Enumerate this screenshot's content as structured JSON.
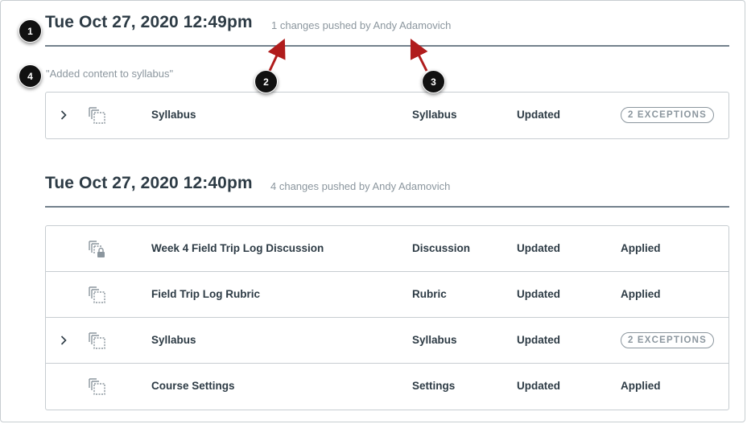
{
  "groups": [
    {
      "timestamp": "Tue Oct 27, 2020 12:49pm",
      "summary": "1 changes pushed by Andy Adamovich",
      "comment": "\"Added content to syllabus\"",
      "rows": [
        {
          "expandable": true,
          "icon": "copy-pages-icon",
          "name": "Syllabus",
          "type": "Syllabus",
          "action": "Updated",
          "badge": "2 EXCEPTIONS",
          "status": ""
        }
      ]
    },
    {
      "timestamp": "Tue Oct 27, 2020 12:40pm",
      "summary": "4 changes pushed by Andy Adamovich",
      "rows": [
        {
          "expandable": false,
          "icon": "locked-copy-icon",
          "name": "Week 4 Field Trip Log Discussion",
          "type": "Discussion",
          "action": "Updated",
          "status": "Applied"
        },
        {
          "expandable": false,
          "icon": "copy-pages-icon",
          "name": "Field Trip Log Rubric",
          "type": "Rubric",
          "action": "Updated",
          "status": "Applied"
        },
        {
          "expandable": true,
          "icon": "copy-pages-icon",
          "name": "Syllabus",
          "type": "Syllabus",
          "action": "Updated",
          "badge": "2 EXCEPTIONS",
          "status": ""
        },
        {
          "expandable": false,
          "icon": "copy-pages-icon",
          "name": "Course Settings",
          "type": "Settings",
          "action": "Updated",
          "status": "Applied"
        }
      ]
    }
  ],
  "markers": [
    "1",
    "2",
    "3",
    "4"
  ],
  "colors": {
    "marker": "#111111",
    "arrow": "#b01c1c",
    "muted": "#8b969e",
    "text": "#2d3b45",
    "border": "#c7cdd1"
  }
}
